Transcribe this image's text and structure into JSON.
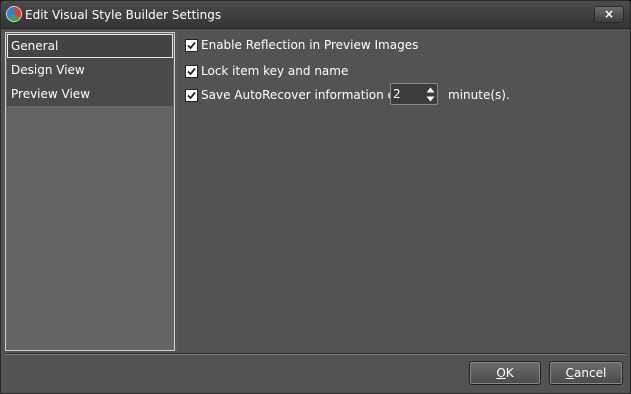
{
  "window": {
    "title": "Edit Visual Style Builder Settings",
    "close_label": "×"
  },
  "sidebar": {
    "items": [
      {
        "label": "General",
        "selected": true
      },
      {
        "label": "Design View",
        "selected": false
      },
      {
        "label": "Preview View",
        "selected": false
      }
    ]
  },
  "general": {
    "reflection": {
      "label": "Enable Reflection in Preview Images",
      "checked": true
    },
    "lock_key": {
      "label": "Lock item key and name",
      "checked": true
    },
    "autorecover": {
      "label": "Save AutoRecover information every",
      "checked": true,
      "value": "2",
      "unit": "minute(s)."
    }
  },
  "buttons": {
    "ok": {
      "mnemonic": "O",
      "rest": "K"
    },
    "cancel": {
      "mnemonic": "C",
      "rest": "ancel"
    }
  },
  "icons": {
    "app": "visual-style-builder-app-icon",
    "close": "close-icon",
    "check": "checkmark-icon",
    "spin_up": "arrow-up-icon",
    "spin_down": "arrow-down-icon"
  }
}
